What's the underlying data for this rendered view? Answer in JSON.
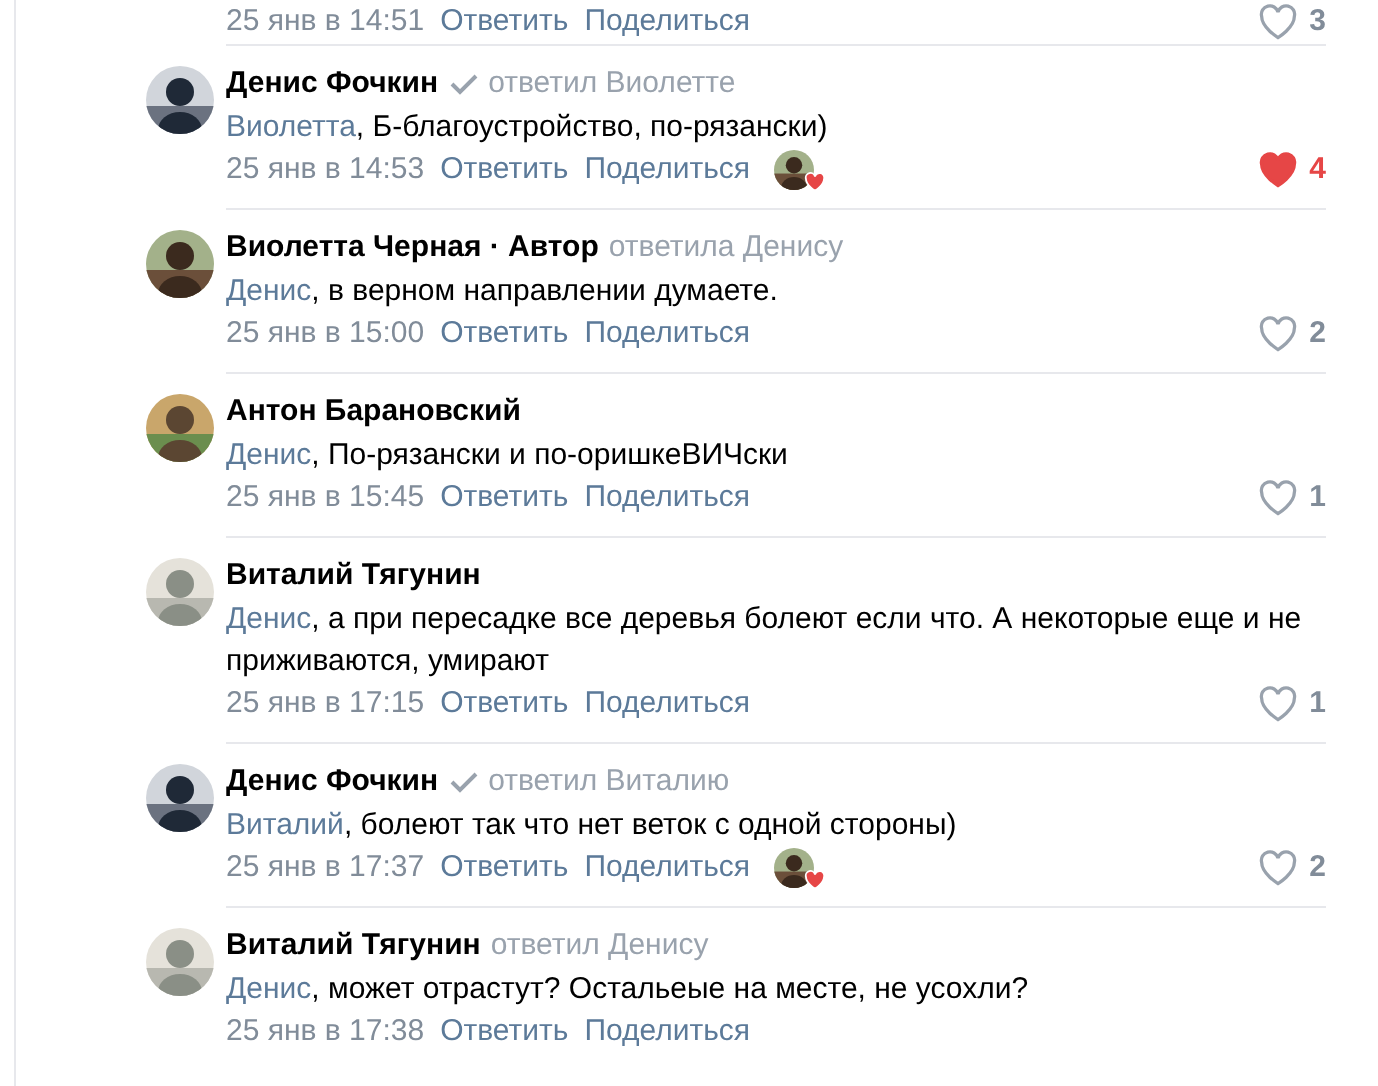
{
  "previous_actions": {
    "time": "25 янв в 14:51",
    "reply": "Ответить",
    "share": "Поделиться",
    "likes": "3",
    "liked": false
  },
  "comments": [
    {
      "author": "Денис Фочкин",
      "verified": true,
      "reply_to": "ответил Виолетте",
      "mention": "Виолетта",
      "text": ", Б-благоустройство, по-рязански)",
      "time": "25 янв в 14:53",
      "reply": "Ответить",
      "share": "Поделиться",
      "liker_shown": true,
      "likes": "4",
      "liked": true
    },
    {
      "author": "Виолетта Черная · Автор",
      "verified": false,
      "reply_to": "ответила Денису",
      "mention": "Денис",
      "text": ", в верном направлении думаете.",
      "time": "25 янв в 15:00",
      "reply": "Ответить",
      "share": "Поделиться",
      "liker_shown": false,
      "likes": "2",
      "liked": false
    },
    {
      "author": "Антон Барановский",
      "verified": false,
      "mention": "Денис",
      "text": ", По-рязански и по-оришкеВИЧски",
      "time": "25 янв в 15:45",
      "reply": "Ответить",
      "share": "Поделиться",
      "liker_shown": false,
      "likes": "1",
      "liked": false
    },
    {
      "author": "Виталий Тягунин",
      "verified": false,
      "mention": "Денис",
      "text": ", а при пересадке все деревья болеют если что. А некоторые еще и не приживаются, умирают",
      "time": "25 янв в 17:15",
      "reply": "Ответить",
      "share": "Поделиться",
      "liker_shown": false,
      "likes": "1",
      "liked": false
    },
    {
      "author": "Денис Фочкин",
      "verified": true,
      "reply_to": "ответил Виталию",
      "mention": "Виталий",
      "text": ", болеют так что нет веток с одной стороны)",
      "time": "25 янв в 17:37",
      "reply": "Ответить",
      "share": "Поделиться",
      "liker_shown": true,
      "likes": "2",
      "liked": false
    },
    {
      "author": "Виталий Тягунин",
      "verified": false,
      "reply_to": "ответил Денису",
      "mention": "Денис",
      "text": ", может отрастут? Остальеые на месте, не усохли?",
      "time": "25 янв в 17:38",
      "reply": "Ответить",
      "share": "Поделиться",
      "liker_shown": false
    }
  ]
}
